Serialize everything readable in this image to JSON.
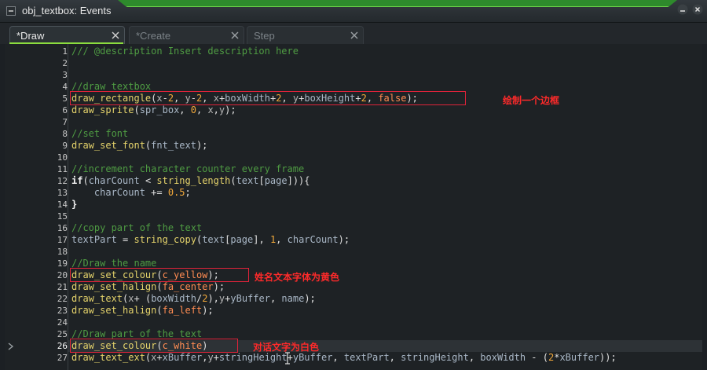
{
  "window": {
    "title": "obj_textbox: Events"
  },
  "tabs": [
    {
      "label": "*Draw",
      "active": true
    },
    {
      "label": "*Create",
      "active": false
    },
    {
      "label": "Step",
      "active": false
    }
  ],
  "editor": {
    "line_numbers": [
      "1",
      "2",
      "3",
      "4",
      "5",
      "6",
      "7",
      "8",
      "9",
      "10",
      "11",
      "12",
      "13",
      "14",
      "15",
      "16",
      "17",
      "18",
      "19",
      "20",
      "21",
      "22",
      "23",
      "24",
      "25",
      "26",
      "27"
    ],
    "current_line": "26"
  },
  "annotations": {
    "rect_note": "绘制一个边框",
    "name_note": "姓名文本字体为黄色",
    "text_note": "对话文字为白色"
  },
  "colors": {
    "accent": "#8bdc3e",
    "annotation": "#e0233a",
    "comment": "#4f9c43",
    "function": "#e5d36b",
    "number": "#f2a93b"
  }
}
